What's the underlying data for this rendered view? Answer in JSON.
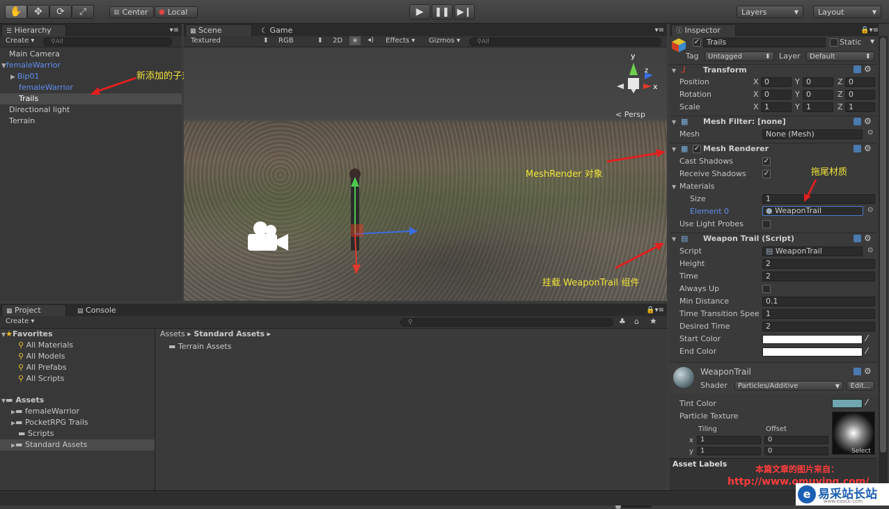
{
  "toolbar": {
    "center_label": "Center",
    "local_label": "Local",
    "layers_label": "Layers",
    "layout_label": "Layout"
  },
  "hierarchy": {
    "tab": "Hierarchy",
    "create": "Create",
    "search_placeholder": "All",
    "items": [
      {
        "label": "Main Camera",
        "color": "#c8c8c8"
      },
      {
        "label": "femaleWarrior",
        "color": "#5f8ff0"
      },
      {
        "label": "Bip01",
        "color": "#5f8ff0"
      },
      {
        "label": "femaleWarrior",
        "color": "#5f8ff0"
      },
      {
        "label": "Trails",
        "color": "#ffffff"
      },
      {
        "label": "Directional light",
        "color": "#c8c8c8"
      },
      {
        "label": "Terrain",
        "color": "#c8c8c8"
      }
    ]
  },
  "scene": {
    "tab_scene": "Scene",
    "tab_game": "Game",
    "render_mode": "Textured",
    "color_mode": "RGB",
    "mode_2d": "2D",
    "effects": "Effects",
    "gizmos": "Gizmos",
    "search_placeholder": "All",
    "persp": "Persp",
    "gizmo_axes": {
      "y": "y",
      "x": "x",
      "z": "z"
    }
  },
  "annotations": {
    "child_object": "新添加的子对象",
    "mesh_render": "MeshRender 对象",
    "trail_material": "拖尾材质",
    "weapon_trail": "挂载 WeaponTrail 组件",
    "source": "本篇文章的图片来自：",
    "source_url": "http://www.omuying.com/",
    "watermark": "易采站长站",
    "watermark_sub": "www.easck.com"
  },
  "inspector": {
    "tab": "Inspector",
    "object_name": "Trails",
    "static_label": "Static",
    "tag_label": "Tag",
    "tag_value": "Untagged",
    "layer_label": "Layer",
    "layer_value": "Default",
    "transform": {
      "title": "Transform",
      "position": {
        "label": "Position",
        "x": "0",
        "y": "0",
        "z": "0"
      },
      "rotation": {
        "label": "Rotation",
        "x": "0",
        "y": "0",
        "z": "0"
      },
      "scale": {
        "label": "Scale",
        "x": "1",
        "y": "1",
        "z": "1"
      }
    },
    "mesh_filter": {
      "title": "Mesh Filter: [none]",
      "mesh_label": "Mesh",
      "mesh_value": "None (Mesh)"
    },
    "mesh_renderer": {
      "title": "Mesh Renderer",
      "cast_shadows": "Cast Shadows",
      "receive_shadows": "Receive Shadows",
      "materials": "Materials",
      "size_label": "Size",
      "size_value": "1",
      "element_label": "Element 0",
      "element_value": "WeaponTrail",
      "use_light_probes": "Use Light Probes"
    },
    "weapon_trail": {
      "title": "Weapon Trail (Script)",
      "script_label": "Script",
      "script_value": "WeaponTrail",
      "height_label": "Height",
      "height_value": "2",
      "time_label": "Time",
      "time_value": "2",
      "always_up": "Always Up",
      "min_distance_label": "Min Distance",
      "min_distance_value": "0.1",
      "tts_label": "Time Transition Spee",
      "tts_value": "1",
      "desired_time_label": "Desired Time",
      "desired_time_value": "2",
      "start_color": "Start Color",
      "end_color": "End Color"
    },
    "material": {
      "name": "WeaponTrail",
      "shader_label": "Shader",
      "shader_value": "Particles/Additive",
      "edit_label": "Edit...",
      "tint_color": "Tint Color",
      "tint_hex": "#6fa6b0",
      "particle_texture": "Particle Texture",
      "tiling": "Tiling",
      "offset": "Offset",
      "x_label": "x",
      "y_label": "y",
      "tiling_x": "1",
      "tiling_y": "1",
      "offset_x": "0",
      "offset_y": "0",
      "select": "Select"
    },
    "asset_labels": "Asset Labels"
  },
  "project": {
    "tab_project": "Project",
    "tab_console": "Console",
    "create": "Create",
    "favorites": "Favorites",
    "fav_items": [
      "All Materials",
      "All Models",
      "All Prefabs",
      "All Scripts"
    ],
    "assets": "Assets",
    "asset_items": [
      "femaleWarrior",
      "PocketRPG Trails",
      "Scripts",
      "Standard Assets"
    ],
    "breadcrumb_root": "Assets",
    "breadcrumb_current": "Standard Assets",
    "folder_items": [
      "Terrain Assets"
    ]
  }
}
